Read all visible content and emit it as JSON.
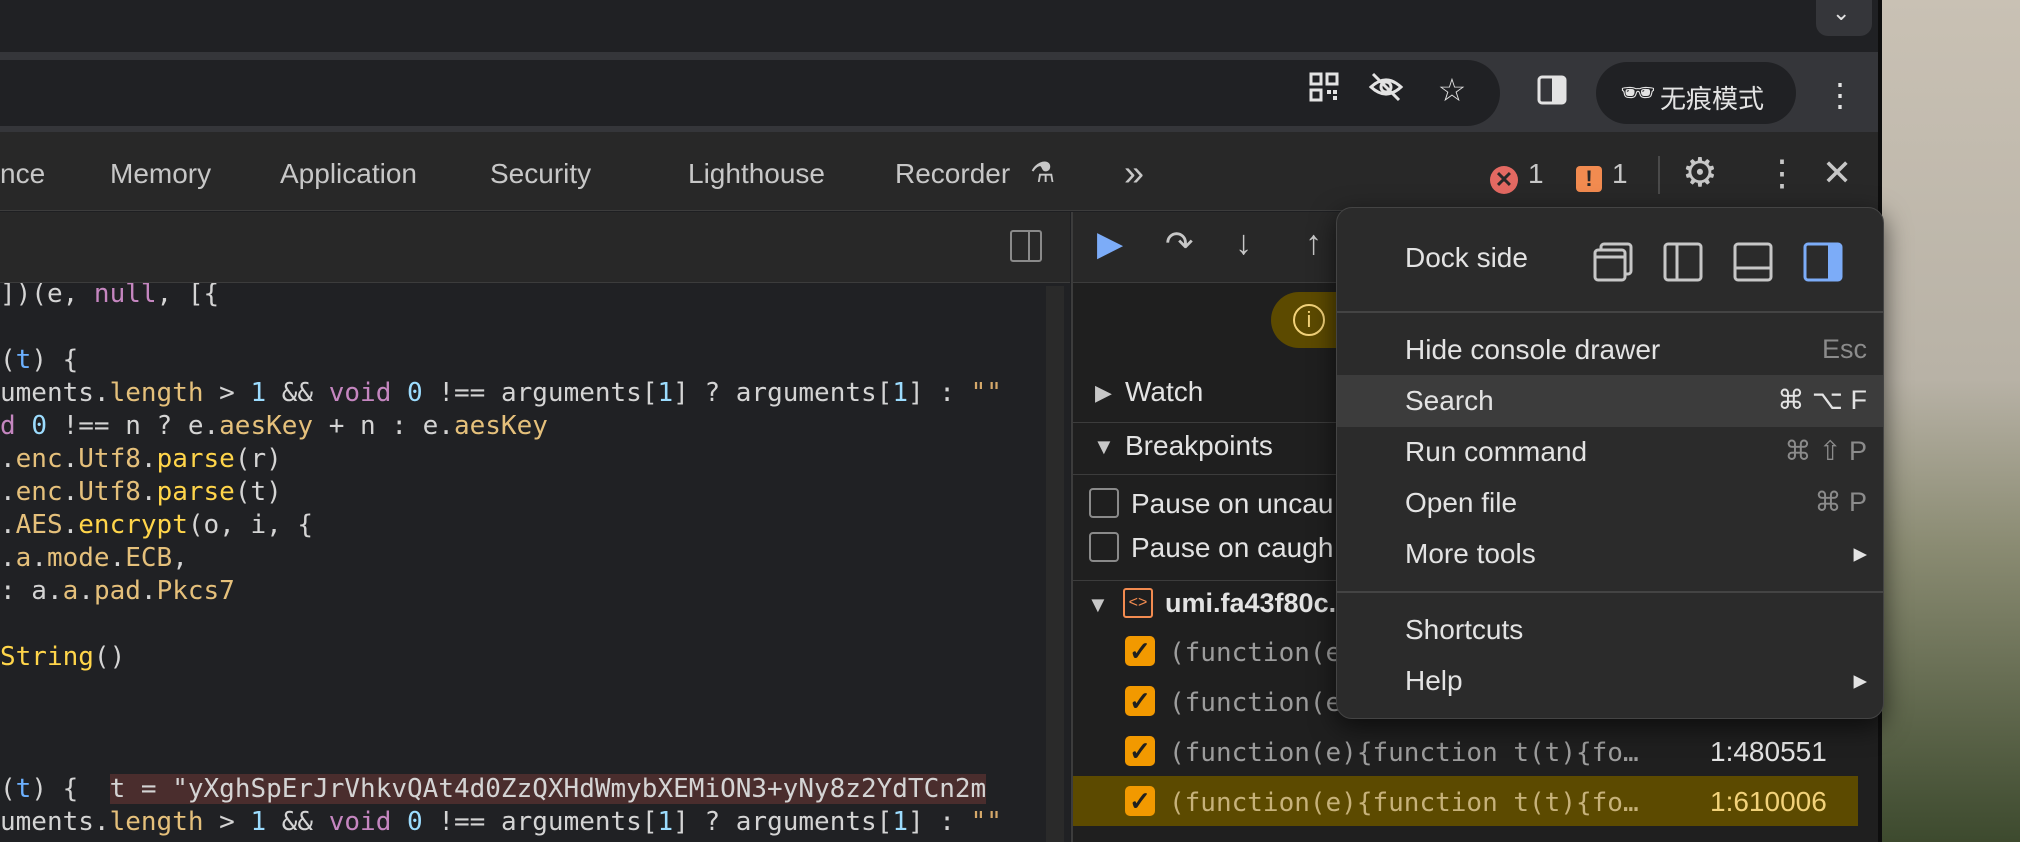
{
  "toolbar": {
    "qr_icon": "qr-code-icon",
    "eye_off_icon": "eye-off-icon",
    "star_icon": "star-icon",
    "side_panel_icon": "side-panel-icon",
    "incognito_label": "无痕模式"
  },
  "devtools": {
    "tabs": [
      {
        "label": "nce"
      },
      {
        "label": "Memory"
      },
      {
        "label": "Application"
      },
      {
        "label": "Security"
      },
      {
        "label": "Lighthouse"
      },
      {
        "label": "Recorder"
      },
      {
        "label": "»"
      }
    ],
    "error_count": "1",
    "warning_count": "1",
    "colors": {
      "error": "#e46962",
      "warning": "#f28b50",
      "accent": "#7cacf8"
    }
  },
  "editor": {
    "lines": [
      [
        {
          "t": "])(e, "
        },
        {
          "t": "null",
          "c": "kw"
        },
        {
          "t": ", [{"
        }
      ],
      [],
      [
        {
          "t": "(",
          "c": ""
        },
        {
          "t": "t",
          "c": "var"
        },
        {
          "t": ") {"
        }
      ],
      [
        {
          "t": "uments."
        },
        {
          "t": "length",
          "c": "prop"
        },
        {
          "t": " > "
        },
        {
          "t": "1",
          "c": "num"
        },
        {
          "t": " && "
        },
        {
          "t": "void",
          "c": "kw"
        },
        {
          "t": " "
        },
        {
          "t": "0",
          "c": "num"
        },
        {
          "t": " !== arguments["
        },
        {
          "t": "1",
          "c": "num"
        },
        {
          "t": "] ? arguments["
        },
        {
          "t": "1",
          "c": "num"
        },
        {
          "t": "] : "
        },
        {
          "t": "\"\"",
          "c": "str"
        }
      ],
      [
        {
          "t": "d",
          "c": "kw"
        },
        {
          "t": " "
        },
        {
          "t": "0",
          "c": "num"
        },
        {
          "t": " !== n ? e."
        },
        {
          "t": "aesKey",
          "c": "prop"
        },
        {
          "t": " + n : e."
        },
        {
          "t": "aesKey",
          "c": "prop"
        }
      ],
      [
        {
          "t": "."
        },
        {
          "t": "enc",
          "c": "prop"
        },
        {
          "t": "."
        },
        {
          "t": "Utf8",
          "c": "prop"
        },
        {
          "t": "."
        },
        {
          "t": "parse",
          "c": "fn"
        },
        {
          "t": "(r)"
        }
      ],
      [
        {
          "t": "."
        },
        {
          "t": "enc",
          "c": "prop"
        },
        {
          "t": "."
        },
        {
          "t": "Utf8",
          "c": "prop"
        },
        {
          "t": "."
        },
        {
          "t": "parse",
          "c": "fn"
        },
        {
          "t": "(t)"
        }
      ],
      [
        {
          "t": "."
        },
        {
          "t": "AES",
          "c": "prop"
        },
        {
          "t": "."
        },
        {
          "t": "encrypt",
          "c": "fn"
        },
        {
          "t": "(o, i, {"
        }
      ],
      [
        {
          "t": "."
        },
        {
          "t": "a",
          "c": "prop"
        },
        {
          "t": "."
        },
        {
          "t": "mode",
          "c": "prop"
        },
        {
          "t": "."
        },
        {
          "t": "ECB",
          "c": "prop"
        },
        {
          "t": ","
        }
      ],
      [
        {
          "t": ": a."
        },
        {
          "t": "a",
          "c": "prop"
        },
        {
          "t": "."
        },
        {
          "t": "pad",
          "c": "prop"
        },
        {
          "t": "."
        },
        {
          "t": "Pkcs7",
          "c": "prop"
        }
      ],
      [],
      [
        {
          "t": "String",
          "c": "fn"
        },
        {
          "t": "()"
        }
      ],
      [],
      [],
      [],
      [
        {
          "t": "("
        },
        {
          "t": "t",
          "c": "var"
        },
        {
          "t": ") {  "
        },
        {
          "t": "t = \"yXghSpErJrVhkvQAt4d0ZzQXHdWmybXEMiON3+yNy8z2YdTCn2m",
          "c": "hl"
        }
      ],
      [
        {
          "t": "uments."
        },
        {
          "t": "length",
          "c": "prop"
        },
        {
          "t": " > "
        },
        {
          "t": "1",
          "c": "num"
        },
        {
          "t": " && "
        },
        {
          "t": "void",
          "c": "kw"
        },
        {
          "t": " "
        },
        {
          "t": "0",
          "c": "num"
        },
        {
          "t": " !== arguments["
        },
        {
          "t": "1",
          "c": "num"
        },
        {
          "t": "] ? arguments["
        },
        {
          "t": "1",
          "c": "num"
        },
        {
          "t": "] : "
        },
        {
          "t": "\"\"",
          "c": "str"
        }
      ]
    ]
  },
  "debugger": {
    "watch_label": "Watch",
    "breakpoints_label": "Breakpoints",
    "pause_uncaught": "Pause on uncau",
    "pause_caught": "Pause on caugh",
    "file_name": "umi.fa43f80c.",
    "rows": [
      {
        "code": "(function(e",
        "line": ""
      },
      {
        "code": "(function(e",
        "line": ""
      },
      {
        "code": "(function(e){function t(t){fo…",
        "line": "1:480551"
      },
      {
        "code": "(function(e){function t(t){fo…",
        "line": "1:610006"
      }
    ]
  },
  "menu": {
    "dock_side_label": "Dock side",
    "items": [
      {
        "label": "Hide console drawer",
        "shortcut": "Esc"
      },
      {
        "label": "Search",
        "shortcut": "⌘ ⌥ F"
      },
      {
        "label": "Run command",
        "shortcut": "⌘ ⇧ P"
      },
      {
        "label": "Open file",
        "shortcut": "⌘ P"
      },
      {
        "label": "More tools",
        "shortcut": "▸"
      },
      {
        "label": "Shortcuts",
        "shortcut": ""
      },
      {
        "label": "Help",
        "shortcut": "▸"
      }
    ]
  }
}
